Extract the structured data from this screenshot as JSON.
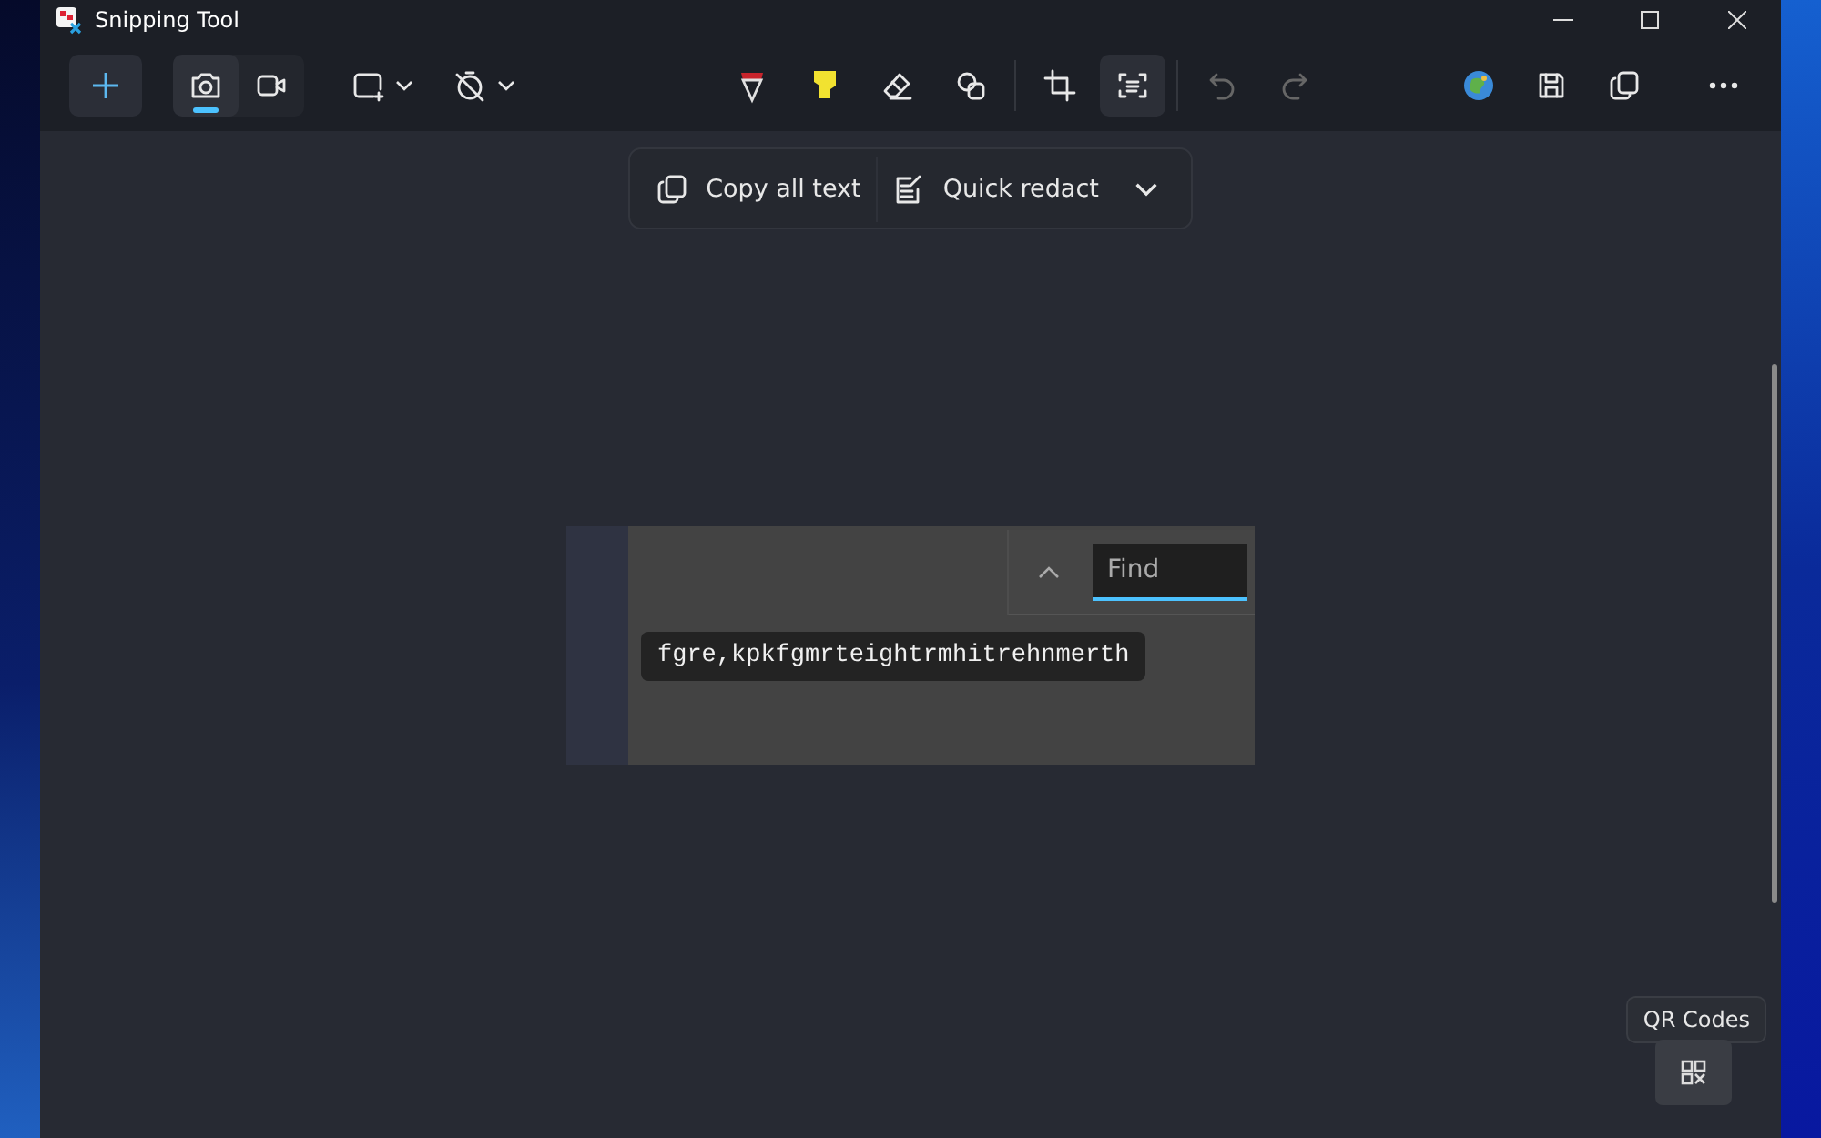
{
  "window": {
    "title": "Snipping Tool"
  },
  "toolbar": {
    "capture_modes": [
      {
        "kind": "photo",
        "selected": true
      },
      {
        "kind": "video",
        "selected": false
      }
    ],
    "markup_tools": [
      {
        "kind": "pen"
      },
      {
        "kind": "highlighter"
      },
      {
        "kind": "eraser"
      },
      {
        "kind": "shapes"
      }
    ],
    "image_tools": [
      {
        "kind": "crop",
        "selected": false
      },
      {
        "kind": "text-actions",
        "selected": true
      }
    ],
    "history": [
      {
        "kind": "undo",
        "disabled": true
      },
      {
        "kind": "redo",
        "disabled": true
      }
    ],
    "actions": [
      {
        "kind": "paint"
      },
      {
        "kind": "save"
      },
      {
        "kind": "copy"
      },
      {
        "kind": "more"
      }
    ]
  },
  "command_bar": {
    "copy_label": "Copy all text",
    "redact_label": "Quick redact"
  },
  "snip": {
    "find": {
      "placeholder": "Find"
    },
    "recognized_text": "fgre,kpkfgmrteightrmhitrehnmerth"
  },
  "qr": {
    "tooltip": "QR Codes"
  }
}
